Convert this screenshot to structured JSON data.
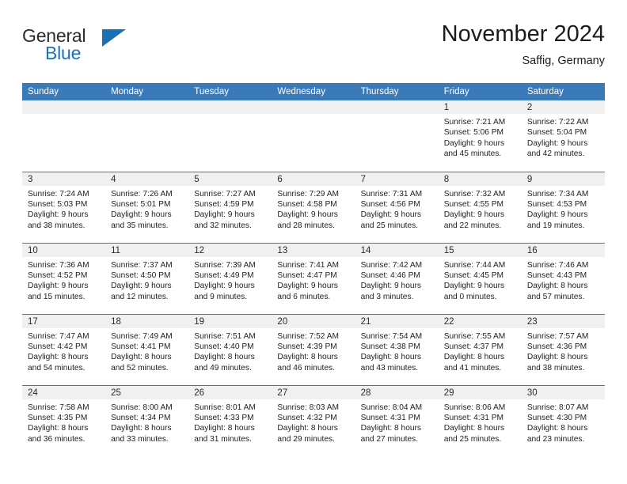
{
  "brand": {
    "name_part1": "General",
    "name_part2": "Blue",
    "accent_color": "#1a6fb5",
    "triangle_icon": "logo-triangle-icon"
  },
  "header": {
    "title": "November 2024",
    "location": "Saffig, Germany"
  },
  "theme": {
    "header_band": "#3a7ab8",
    "daynum_band": "#f0f0f0",
    "text": "#222222"
  },
  "weekdays": [
    "Sunday",
    "Monday",
    "Tuesday",
    "Wednesday",
    "Thursday",
    "Friday",
    "Saturday"
  ],
  "labels": {
    "sunrise": "Sunrise:",
    "sunset": "Sunset:",
    "daylight": "Daylight:"
  },
  "weeks": [
    [
      {
        "day": "",
        "empty": true
      },
      {
        "day": "",
        "empty": true
      },
      {
        "day": "",
        "empty": true
      },
      {
        "day": "",
        "empty": true
      },
      {
        "day": "",
        "empty": true
      },
      {
        "day": "1",
        "sunrise": "Sunrise: 7:21 AM",
        "sunset": "Sunset: 5:06 PM",
        "daylight1": "Daylight: 9 hours",
        "daylight2": "and 45 minutes."
      },
      {
        "day": "2",
        "sunrise": "Sunrise: 7:22 AM",
        "sunset": "Sunset: 5:04 PM",
        "daylight1": "Daylight: 9 hours",
        "daylight2": "and 42 minutes."
      }
    ],
    [
      {
        "day": "3",
        "sunrise": "Sunrise: 7:24 AM",
        "sunset": "Sunset: 5:03 PM",
        "daylight1": "Daylight: 9 hours",
        "daylight2": "and 38 minutes."
      },
      {
        "day": "4",
        "sunrise": "Sunrise: 7:26 AM",
        "sunset": "Sunset: 5:01 PM",
        "daylight1": "Daylight: 9 hours",
        "daylight2": "and 35 minutes."
      },
      {
        "day": "5",
        "sunrise": "Sunrise: 7:27 AM",
        "sunset": "Sunset: 4:59 PM",
        "daylight1": "Daylight: 9 hours",
        "daylight2": "and 32 minutes."
      },
      {
        "day": "6",
        "sunrise": "Sunrise: 7:29 AM",
        "sunset": "Sunset: 4:58 PM",
        "daylight1": "Daylight: 9 hours",
        "daylight2": "and 28 minutes."
      },
      {
        "day": "7",
        "sunrise": "Sunrise: 7:31 AM",
        "sunset": "Sunset: 4:56 PM",
        "daylight1": "Daylight: 9 hours",
        "daylight2": "and 25 minutes."
      },
      {
        "day": "8",
        "sunrise": "Sunrise: 7:32 AM",
        "sunset": "Sunset: 4:55 PM",
        "daylight1": "Daylight: 9 hours",
        "daylight2": "and 22 minutes."
      },
      {
        "day": "9",
        "sunrise": "Sunrise: 7:34 AM",
        "sunset": "Sunset: 4:53 PM",
        "daylight1": "Daylight: 9 hours",
        "daylight2": "and 19 minutes."
      }
    ],
    [
      {
        "day": "10",
        "sunrise": "Sunrise: 7:36 AM",
        "sunset": "Sunset: 4:52 PM",
        "daylight1": "Daylight: 9 hours",
        "daylight2": "and 15 minutes."
      },
      {
        "day": "11",
        "sunrise": "Sunrise: 7:37 AM",
        "sunset": "Sunset: 4:50 PM",
        "daylight1": "Daylight: 9 hours",
        "daylight2": "and 12 minutes."
      },
      {
        "day": "12",
        "sunrise": "Sunrise: 7:39 AM",
        "sunset": "Sunset: 4:49 PM",
        "daylight1": "Daylight: 9 hours",
        "daylight2": "and 9 minutes."
      },
      {
        "day": "13",
        "sunrise": "Sunrise: 7:41 AM",
        "sunset": "Sunset: 4:47 PM",
        "daylight1": "Daylight: 9 hours",
        "daylight2": "and 6 minutes."
      },
      {
        "day": "14",
        "sunrise": "Sunrise: 7:42 AM",
        "sunset": "Sunset: 4:46 PM",
        "daylight1": "Daylight: 9 hours",
        "daylight2": "and 3 minutes."
      },
      {
        "day": "15",
        "sunrise": "Sunrise: 7:44 AM",
        "sunset": "Sunset: 4:45 PM",
        "daylight1": "Daylight: 9 hours",
        "daylight2": "and 0 minutes."
      },
      {
        "day": "16",
        "sunrise": "Sunrise: 7:46 AM",
        "sunset": "Sunset: 4:43 PM",
        "daylight1": "Daylight: 8 hours",
        "daylight2": "and 57 minutes."
      }
    ],
    [
      {
        "day": "17",
        "sunrise": "Sunrise: 7:47 AM",
        "sunset": "Sunset: 4:42 PM",
        "daylight1": "Daylight: 8 hours",
        "daylight2": "and 54 minutes."
      },
      {
        "day": "18",
        "sunrise": "Sunrise: 7:49 AM",
        "sunset": "Sunset: 4:41 PM",
        "daylight1": "Daylight: 8 hours",
        "daylight2": "and 52 minutes."
      },
      {
        "day": "19",
        "sunrise": "Sunrise: 7:51 AM",
        "sunset": "Sunset: 4:40 PM",
        "daylight1": "Daylight: 8 hours",
        "daylight2": "and 49 minutes."
      },
      {
        "day": "20",
        "sunrise": "Sunrise: 7:52 AM",
        "sunset": "Sunset: 4:39 PM",
        "daylight1": "Daylight: 8 hours",
        "daylight2": "and 46 minutes."
      },
      {
        "day": "21",
        "sunrise": "Sunrise: 7:54 AM",
        "sunset": "Sunset: 4:38 PM",
        "daylight1": "Daylight: 8 hours",
        "daylight2": "and 43 minutes."
      },
      {
        "day": "22",
        "sunrise": "Sunrise: 7:55 AM",
        "sunset": "Sunset: 4:37 PM",
        "daylight1": "Daylight: 8 hours",
        "daylight2": "and 41 minutes."
      },
      {
        "day": "23",
        "sunrise": "Sunrise: 7:57 AM",
        "sunset": "Sunset: 4:36 PM",
        "daylight1": "Daylight: 8 hours",
        "daylight2": "and 38 minutes."
      }
    ],
    [
      {
        "day": "24",
        "sunrise": "Sunrise: 7:58 AM",
        "sunset": "Sunset: 4:35 PM",
        "daylight1": "Daylight: 8 hours",
        "daylight2": "and 36 minutes."
      },
      {
        "day": "25",
        "sunrise": "Sunrise: 8:00 AM",
        "sunset": "Sunset: 4:34 PM",
        "daylight1": "Daylight: 8 hours",
        "daylight2": "and 33 minutes."
      },
      {
        "day": "26",
        "sunrise": "Sunrise: 8:01 AM",
        "sunset": "Sunset: 4:33 PM",
        "daylight1": "Daylight: 8 hours",
        "daylight2": "and 31 minutes."
      },
      {
        "day": "27",
        "sunrise": "Sunrise: 8:03 AM",
        "sunset": "Sunset: 4:32 PM",
        "daylight1": "Daylight: 8 hours",
        "daylight2": "and 29 minutes."
      },
      {
        "day": "28",
        "sunrise": "Sunrise: 8:04 AM",
        "sunset": "Sunset: 4:31 PM",
        "daylight1": "Daylight: 8 hours",
        "daylight2": "and 27 minutes."
      },
      {
        "day": "29",
        "sunrise": "Sunrise: 8:06 AM",
        "sunset": "Sunset: 4:31 PM",
        "daylight1": "Daylight: 8 hours",
        "daylight2": "and 25 minutes."
      },
      {
        "day": "30",
        "sunrise": "Sunrise: 8:07 AM",
        "sunset": "Sunset: 4:30 PM",
        "daylight1": "Daylight: 8 hours",
        "daylight2": "and 23 minutes."
      }
    ]
  ]
}
